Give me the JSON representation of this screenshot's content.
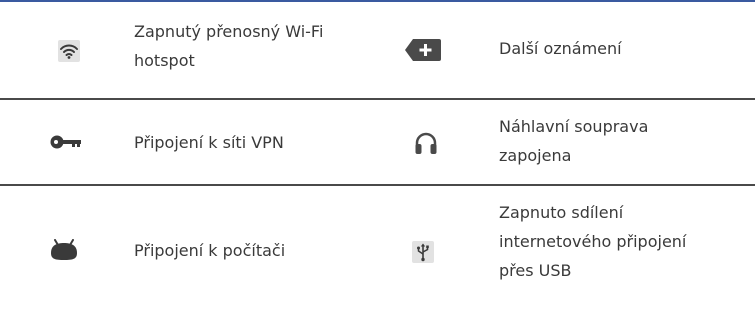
{
  "colors": {
    "top_rule": "#3a5aa0",
    "divider": "#4a4a4a",
    "icon_fill": "#4a4a4a",
    "text": "#3a3a3a"
  },
  "rows": [
    {
      "left": {
        "icon": "wifi-hotspot-icon",
        "lines": [
          "Zapnutý přenosný Wi-Fi",
          "hotspot"
        ]
      },
      "right": {
        "icon": "more-notifications-icon",
        "lines": [
          "Další oznámení"
        ]
      }
    },
    {
      "left": {
        "icon": "vpn-key-icon",
        "lines": [
          "Připojení k síti VPN"
        ]
      },
      "right": {
        "icon": "headset-icon",
        "lines": [
          "Náhlavní souprava",
          "zapojena"
        ]
      }
    },
    {
      "left": {
        "icon": "android-pc-connection-icon",
        "lines": [
          "Připojení k počítači"
        ]
      },
      "right": {
        "icon": "usb-tethering-icon",
        "lines": [
          "Zapnuto sdílení",
          "internetového připojení",
          "přes USB"
        ]
      }
    }
  ]
}
